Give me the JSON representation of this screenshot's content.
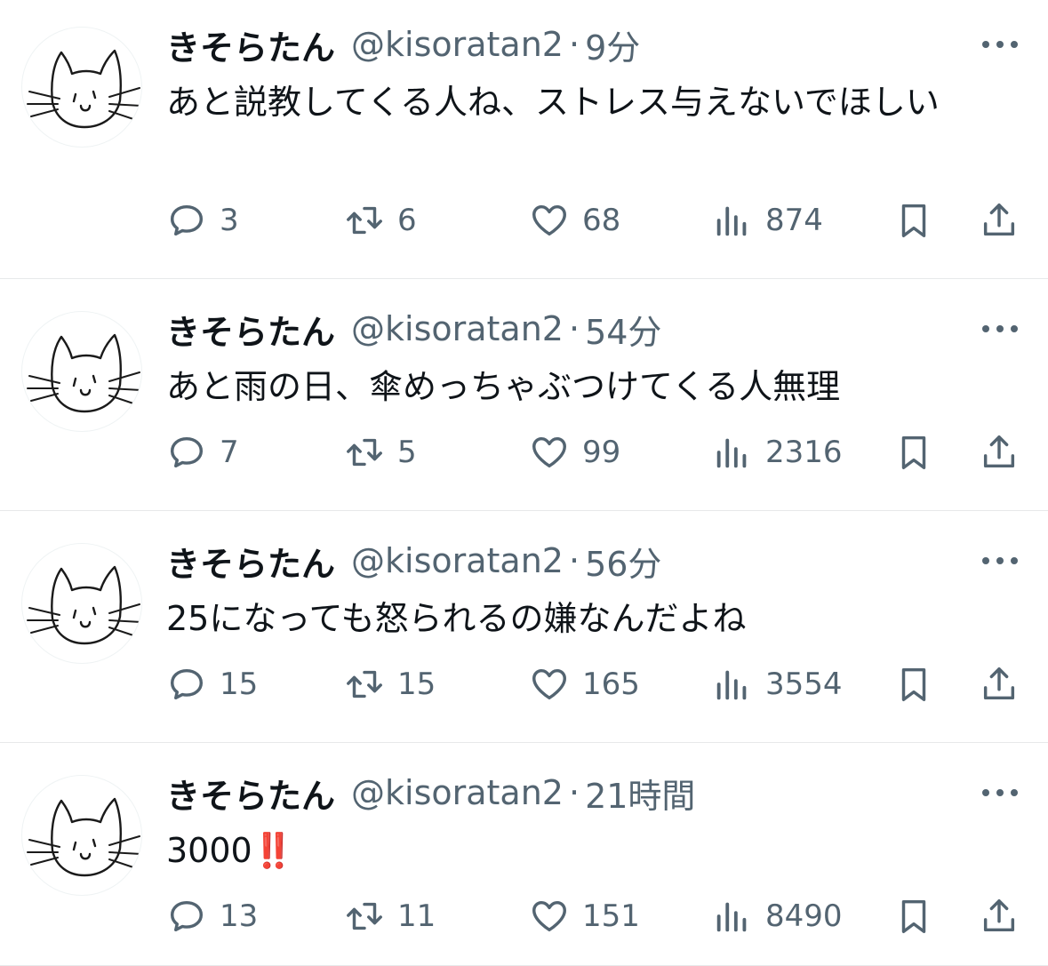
{
  "icons": [
    "cat-avatar",
    "reply-icon",
    "retweet-icon",
    "like-icon",
    "views-icon",
    "bookmark-icon",
    "share-icon",
    "more-icon"
  ],
  "colors": {
    "text": "#0f1419",
    "secondary": "#536471",
    "divider": "#e7e9ea",
    "emoji_red": "#e0211d"
  },
  "tweets": [
    {
      "name": "きそらたん",
      "handle": "@kisoratan2",
      "dot": "·",
      "time": "9分",
      "text": "あと説教してくる人ね、ストレス与えないでほしい",
      "emoji": "",
      "replies": "3",
      "retweets": "6",
      "likes": "68",
      "views": "874"
    },
    {
      "name": "きそらたん",
      "handle": "@kisoratan2",
      "dot": "·",
      "time": "54分",
      "text": "あと雨の日、傘めっちゃぶつけてくる人無理",
      "emoji": "",
      "replies": "7",
      "retweets": "5",
      "likes": "99",
      "views": "2316"
    },
    {
      "name": "きそらたん",
      "handle": "@kisoratan2",
      "dot": "·",
      "time": "56分",
      "text": "25になっても怒られるの嫌なんだよね",
      "emoji": "",
      "replies": "15",
      "retweets": "15",
      "likes": "165",
      "views": "3554"
    },
    {
      "name": "きそらたん",
      "handle": "@kisoratan2",
      "dot": "·",
      "time": "21時間",
      "text": "3000",
      "emoji": "‼️",
      "replies": "13",
      "retweets": "11",
      "likes": "151",
      "views": "8490"
    }
  ]
}
